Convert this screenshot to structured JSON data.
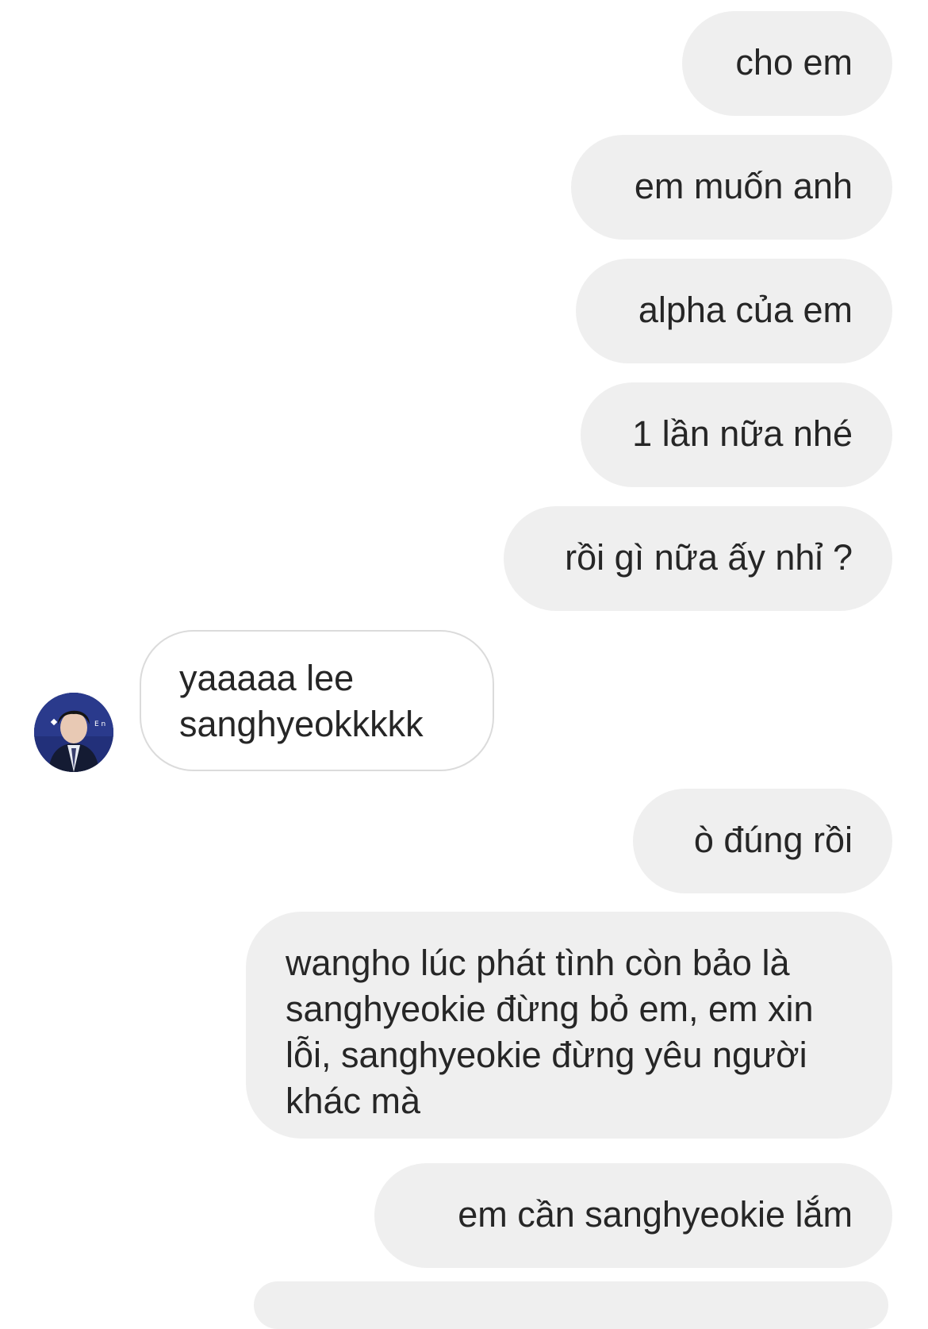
{
  "messages": [
    {
      "direction": "outgoing",
      "text": "cho em"
    },
    {
      "direction": "outgoing",
      "text": "em muốn anh"
    },
    {
      "direction": "outgoing",
      "text": "alpha của em"
    },
    {
      "direction": "outgoing",
      "text": "1 lần nữa nhé"
    },
    {
      "direction": "outgoing",
      "text": "rồi gì nữa ấy nhỉ ?"
    },
    {
      "direction": "incoming",
      "text": "yaaaaa lee sanghyeokkkkk"
    },
    {
      "direction": "outgoing",
      "text": "ò đúng rồi"
    },
    {
      "direction": "outgoing",
      "text": "wangho lúc phát tình còn bảo là sanghyeokie đừng bỏ em, em xin lỗi, sanghyeokie đừng yêu người khác mà"
    },
    {
      "direction": "outgoing",
      "text": "em cần sanghyeokie lắm"
    }
  ],
  "colors": {
    "outgoing_bubble": "#efefef",
    "incoming_border": "#dbdbdb",
    "text": "#262626"
  },
  "icons": {
    "sender_avatar": "profile-photo-avatar"
  }
}
